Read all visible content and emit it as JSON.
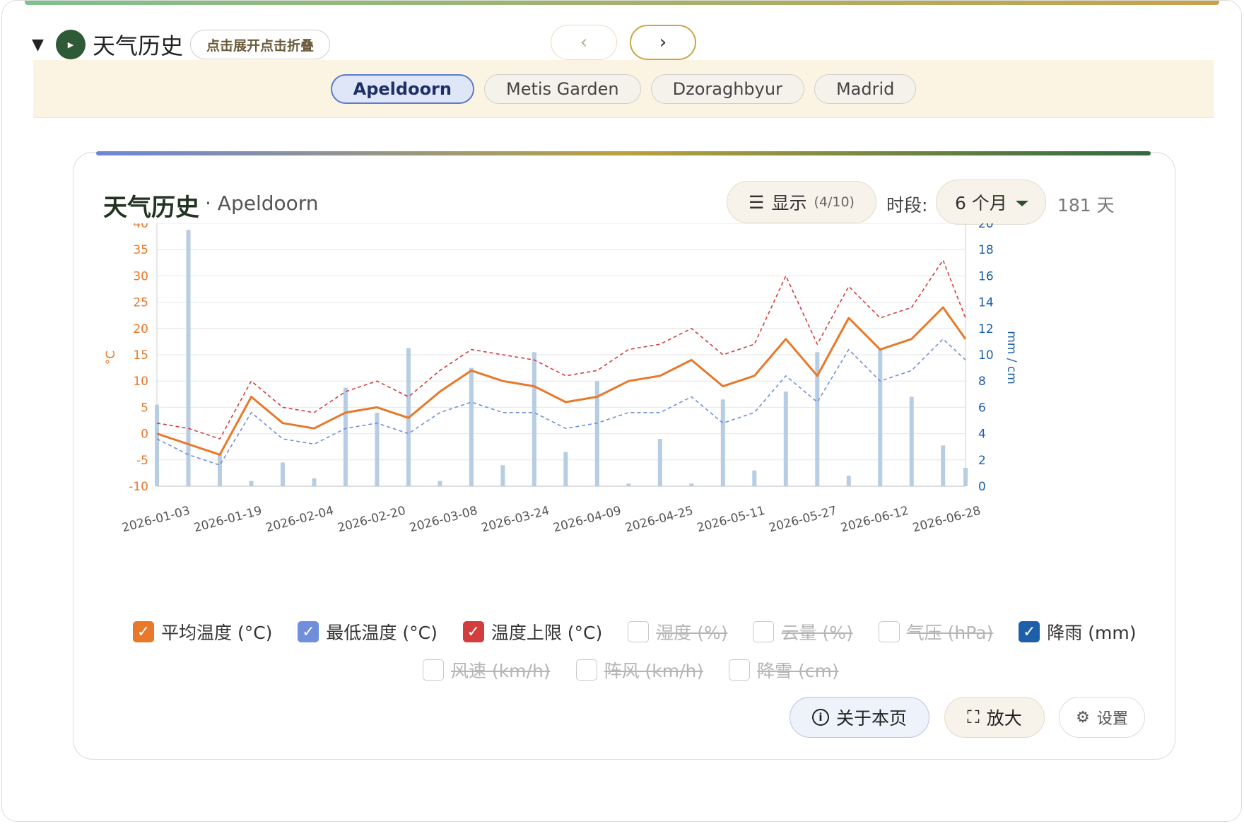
{
  "header": {
    "title": "天气历史",
    "toggle_label": "点击展开点击折叠",
    "prev_label": "‹",
    "next_label": "›"
  },
  "locations": [
    {
      "label": "Apeldoorn",
      "active": true
    },
    {
      "label": "Metis Garden",
      "active": false
    },
    {
      "label": "Dzoraghbyur",
      "active": false
    },
    {
      "label": "Madrid",
      "active": false
    }
  ],
  "card": {
    "title": "天气历史",
    "subtitle": "· Apeldoorn",
    "show_label": "显示",
    "show_count": "(4/10)",
    "period_label": "时段:",
    "period_value": "6 个月",
    "days_label": "181 天"
  },
  "colors": {
    "avg": "#e8782a",
    "min": "#6f8fdc",
    "max": "#d23d3d",
    "rain": "#b7cde3",
    "rain_check": "#1d5fa8"
  },
  "legend": [
    {
      "label": "平均温度 (°C)",
      "checked": true,
      "color": "#e8782a"
    },
    {
      "label": "最低温度 (°C)",
      "checked": true,
      "color": "#6f8fdc"
    },
    {
      "label": "温度上限 (°C)",
      "checked": true,
      "color": "#d23d3d"
    },
    {
      "label": "湿度 (%)",
      "checked": false
    },
    {
      "label": "云量 (%)",
      "checked": false
    },
    {
      "label": "气压 (hPa)",
      "checked": false
    },
    {
      "label": "降雨 (mm)",
      "checked": true,
      "color": "#1d5fa8"
    },
    {
      "label": "风速 (km/h)",
      "checked": false
    },
    {
      "label": "阵风 (km/h)",
      "checked": false
    },
    {
      "label": "降雪 (cm)",
      "checked": false
    }
  ],
  "buttons": {
    "about": "关于本页",
    "zoom": "放大",
    "settings": "设置"
  },
  "chart_data": {
    "type": "line",
    "title": "",
    "ylabel": "°C",
    "y2label": "mm / cm",
    "ylim": [
      -10,
      40
    ],
    "y2lim": [
      0,
      20
    ],
    "yticks": [
      -10,
      -5,
      0,
      5,
      10,
      15,
      20,
      25,
      30,
      35,
      40
    ],
    "y2ticks": [
      0,
      2,
      4,
      6,
      8,
      10,
      12,
      14,
      16,
      18,
      20
    ],
    "x": [
      "2026-01-03",
      "2026-01-10",
      "2026-01-17",
      "2026-01-24",
      "2026-01-31",
      "2026-02-07",
      "2026-02-14",
      "2026-02-21",
      "2026-02-28",
      "2026-03-07",
      "2026-03-14",
      "2026-03-21",
      "2026-03-28",
      "2026-04-04",
      "2026-04-11",
      "2026-04-18",
      "2026-04-25",
      "2026-05-02",
      "2026-05-09",
      "2026-05-16",
      "2026-05-23",
      "2026-05-30",
      "2026-06-06",
      "2026-06-13",
      "2026-06-20",
      "2026-06-27",
      "2026-07-02"
    ],
    "xticks": [
      "2026-01-03",
      "2026-01-19",
      "2026-02-04",
      "2026-02-20",
      "2026-03-08",
      "2026-03-24",
      "2026-04-09",
      "2026-04-25",
      "2026-05-11",
      "2026-05-27",
      "2026-06-12",
      "2026-06-28"
    ],
    "grid": true,
    "series": [
      {
        "name": "平均温度 (°C)",
        "axis": "left",
        "style": "solid",
        "values": [
          0,
          -2,
          -4,
          7,
          2,
          1,
          4,
          5,
          3,
          8,
          12,
          10,
          9,
          6,
          7,
          10,
          11,
          14,
          9,
          11,
          18,
          11,
          22,
          16,
          18,
          24,
          18
        ]
      },
      {
        "name": "最低温度 (°C)",
        "axis": "left",
        "style": "dashed",
        "values": [
          -1,
          -4,
          -6,
          4,
          -1,
          -2,
          1,
          2,
          0,
          4,
          6,
          4,
          4,
          1,
          2,
          4,
          4,
          7,
          2,
          4,
          11,
          6,
          16,
          10,
          12,
          18,
          14
        ]
      },
      {
        "name": "温度上限 (°C)",
        "axis": "left",
        "style": "dashed",
        "values": [
          2,
          1,
          -1,
          10,
          5,
          4,
          8,
          10,
          7,
          12,
          16,
          15,
          14,
          11,
          12,
          16,
          17,
          20,
          15,
          17,
          30,
          17,
          28,
          22,
          24,
          33,
          22
        ]
      },
      {
        "name": "降雨 (mm)",
        "axis": "right",
        "style": "bar",
        "values": [
          6.2,
          19.5,
          2.5,
          0.4,
          1.8,
          0.6,
          7.5,
          5.6,
          10.5,
          0.4,
          9.0,
          1.6,
          10.2,
          2.6,
          8.0,
          0.2,
          3.6,
          0.2,
          6.6,
          1.2,
          7.2,
          10.2,
          0.8,
          10.5,
          6.8,
          3.1,
          1.4
        ]
      }
    ]
  }
}
